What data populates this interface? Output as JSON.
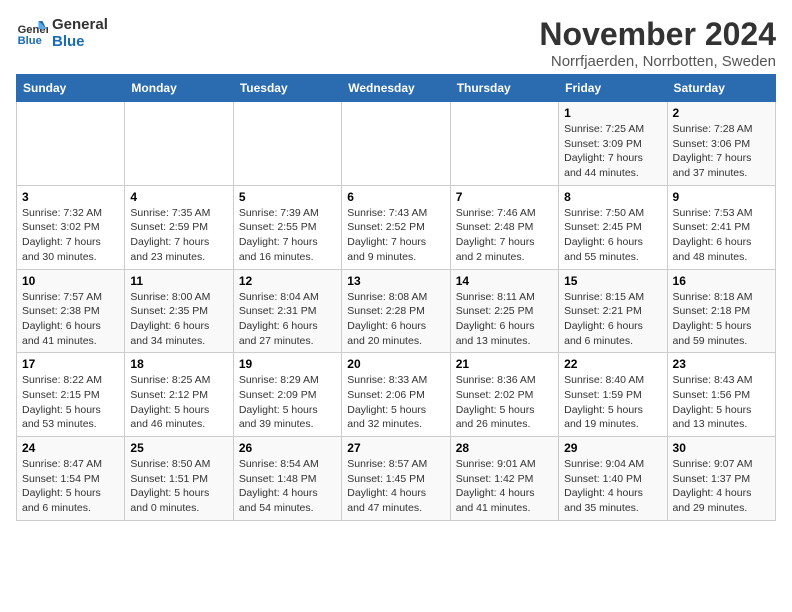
{
  "logo": {
    "line1": "General",
    "line2": "Blue"
  },
  "title": "November 2024",
  "subtitle": "Norrfjaerden, Norrbotten, Sweden",
  "weekdays": [
    "Sunday",
    "Monday",
    "Tuesday",
    "Wednesday",
    "Thursday",
    "Friday",
    "Saturday"
  ],
  "weeks": [
    [
      {
        "day": "",
        "info": ""
      },
      {
        "day": "",
        "info": ""
      },
      {
        "day": "",
        "info": ""
      },
      {
        "day": "",
        "info": ""
      },
      {
        "day": "",
        "info": ""
      },
      {
        "day": "1",
        "info": "Sunrise: 7:25 AM\nSunset: 3:09 PM\nDaylight: 7 hours\nand 44 minutes."
      },
      {
        "day": "2",
        "info": "Sunrise: 7:28 AM\nSunset: 3:06 PM\nDaylight: 7 hours\nand 37 minutes."
      }
    ],
    [
      {
        "day": "3",
        "info": "Sunrise: 7:32 AM\nSunset: 3:02 PM\nDaylight: 7 hours\nand 30 minutes."
      },
      {
        "day": "4",
        "info": "Sunrise: 7:35 AM\nSunset: 2:59 PM\nDaylight: 7 hours\nand 23 minutes."
      },
      {
        "day": "5",
        "info": "Sunrise: 7:39 AM\nSunset: 2:55 PM\nDaylight: 7 hours\nand 16 minutes."
      },
      {
        "day": "6",
        "info": "Sunrise: 7:43 AM\nSunset: 2:52 PM\nDaylight: 7 hours\nand 9 minutes."
      },
      {
        "day": "7",
        "info": "Sunrise: 7:46 AM\nSunset: 2:48 PM\nDaylight: 7 hours\nand 2 minutes."
      },
      {
        "day": "8",
        "info": "Sunrise: 7:50 AM\nSunset: 2:45 PM\nDaylight: 6 hours\nand 55 minutes."
      },
      {
        "day": "9",
        "info": "Sunrise: 7:53 AM\nSunset: 2:41 PM\nDaylight: 6 hours\nand 48 minutes."
      }
    ],
    [
      {
        "day": "10",
        "info": "Sunrise: 7:57 AM\nSunset: 2:38 PM\nDaylight: 6 hours\nand 41 minutes."
      },
      {
        "day": "11",
        "info": "Sunrise: 8:00 AM\nSunset: 2:35 PM\nDaylight: 6 hours\nand 34 minutes."
      },
      {
        "day": "12",
        "info": "Sunrise: 8:04 AM\nSunset: 2:31 PM\nDaylight: 6 hours\nand 27 minutes."
      },
      {
        "day": "13",
        "info": "Sunrise: 8:08 AM\nSunset: 2:28 PM\nDaylight: 6 hours\nand 20 minutes."
      },
      {
        "day": "14",
        "info": "Sunrise: 8:11 AM\nSunset: 2:25 PM\nDaylight: 6 hours\nand 13 minutes."
      },
      {
        "day": "15",
        "info": "Sunrise: 8:15 AM\nSunset: 2:21 PM\nDaylight: 6 hours\nand 6 minutes."
      },
      {
        "day": "16",
        "info": "Sunrise: 8:18 AM\nSunset: 2:18 PM\nDaylight: 5 hours\nand 59 minutes."
      }
    ],
    [
      {
        "day": "17",
        "info": "Sunrise: 8:22 AM\nSunset: 2:15 PM\nDaylight: 5 hours\nand 53 minutes."
      },
      {
        "day": "18",
        "info": "Sunrise: 8:25 AM\nSunset: 2:12 PM\nDaylight: 5 hours\nand 46 minutes."
      },
      {
        "day": "19",
        "info": "Sunrise: 8:29 AM\nSunset: 2:09 PM\nDaylight: 5 hours\nand 39 minutes."
      },
      {
        "day": "20",
        "info": "Sunrise: 8:33 AM\nSunset: 2:06 PM\nDaylight: 5 hours\nand 32 minutes."
      },
      {
        "day": "21",
        "info": "Sunrise: 8:36 AM\nSunset: 2:02 PM\nDaylight: 5 hours\nand 26 minutes."
      },
      {
        "day": "22",
        "info": "Sunrise: 8:40 AM\nSunset: 1:59 PM\nDaylight: 5 hours\nand 19 minutes."
      },
      {
        "day": "23",
        "info": "Sunrise: 8:43 AM\nSunset: 1:56 PM\nDaylight: 5 hours\nand 13 minutes."
      }
    ],
    [
      {
        "day": "24",
        "info": "Sunrise: 8:47 AM\nSunset: 1:54 PM\nDaylight: 5 hours\nand 6 minutes."
      },
      {
        "day": "25",
        "info": "Sunrise: 8:50 AM\nSunset: 1:51 PM\nDaylight: 5 hours\nand 0 minutes."
      },
      {
        "day": "26",
        "info": "Sunrise: 8:54 AM\nSunset: 1:48 PM\nDaylight: 4 hours\nand 54 minutes."
      },
      {
        "day": "27",
        "info": "Sunrise: 8:57 AM\nSunset: 1:45 PM\nDaylight: 4 hours\nand 47 minutes."
      },
      {
        "day": "28",
        "info": "Sunrise: 9:01 AM\nSunset: 1:42 PM\nDaylight: 4 hours\nand 41 minutes."
      },
      {
        "day": "29",
        "info": "Sunrise: 9:04 AM\nSunset: 1:40 PM\nDaylight: 4 hours\nand 35 minutes."
      },
      {
        "day": "30",
        "info": "Sunrise: 9:07 AM\nSunset: 1:37 PM\nDaylight: 4 hours\nand 29 minutes."
      }
    ]
  ]
}
